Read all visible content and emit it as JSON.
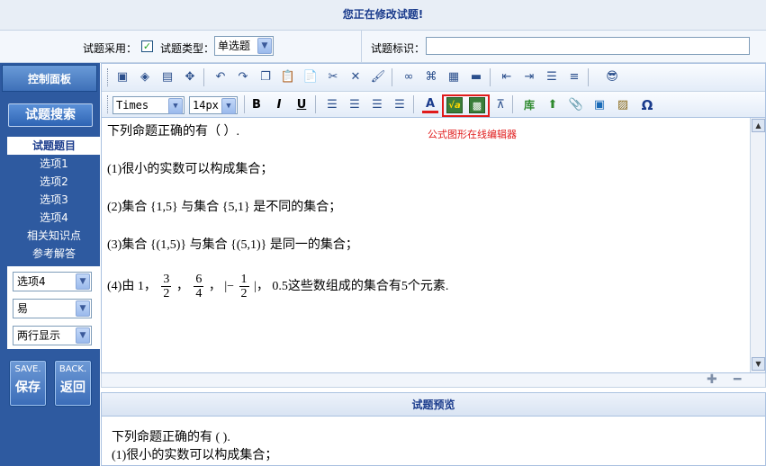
{
  "header": {
    "title": "您正在修改试题!"
  },
  "form": {
    "adopt_label": "试题采用：",
    "checkbox_mark": "✓",
    "type_label": "试题类型：",
    "type_value": "单选题",
    "tag_label": "试题标识：",
    "tag_value": ""
  },
  "sidebar": {
    "panel_title": "控制面板",
    "search_button": "试题搜索",
    "items": [
      {
        "label": "试题题目",
        "active": true
      },
      {
        "label": "选项1"
      },
      {
        "label": "选项2"
      },
      {
        "label": "选项3"
      },
      {
        "label": "选项4"
      },
      {
        "label": "相关知识点"
      },
      {
        "label": "参考解答"
      }
    ],
    "selects": {
      "option": "选项4",
      "difficulty": "易",
      "display": "两行显示"
    },
    "save": {
      "small": "SAVE.",
      "label": "保存"
    },
    "back": {
      "small": "BACK.",
      "label": "返回"
    }
  },
  "toolbar": {
    "font_family": "Times",
    "font_size": "14px",
    "bold": "B",
    "italic": "I",
    "underline": "U",
    "text_color_glyph": "A",
    "lib_glyph": "库",
    "omega": "Ω",
    "formula_note": "公式图形在线编辑器"
  },
  "editor": {
    "l0": "下列命题正确的有（  ）.",
    "l1": "(1)很小的实数可以构成集合；",
    "l2": "(2)集合 {1,5} 与集合 {5,1} 是不同的集合；",
    "l3": "(3)集合 {(1,5)} 与集合 {(5,1)} 是同一的集合；",
    "l4a": "(4)由 1，",
    "f1n": "3",
    "f1d": "2",
    "sep1": "，",
    "f2n": "6",
    "f2d": "4",
    "sep2": "，",
    "abs_open": "|−",
    "f3n": "1",
    "f3d": "2",
    "abs_close": "|，",
    "l4b": "0.5这些数组成的集合有5个元素."
  },
  "preview": {
    "title": "试题预览",
    "line1": "下列命题正确的有 ( ).",
    "line2": "(1)很小的实数可以构成集合；"
  },
  "colors": {
    "accent": "#2e5aa0",
    "highlight": "#e01b1b"
  }
}
